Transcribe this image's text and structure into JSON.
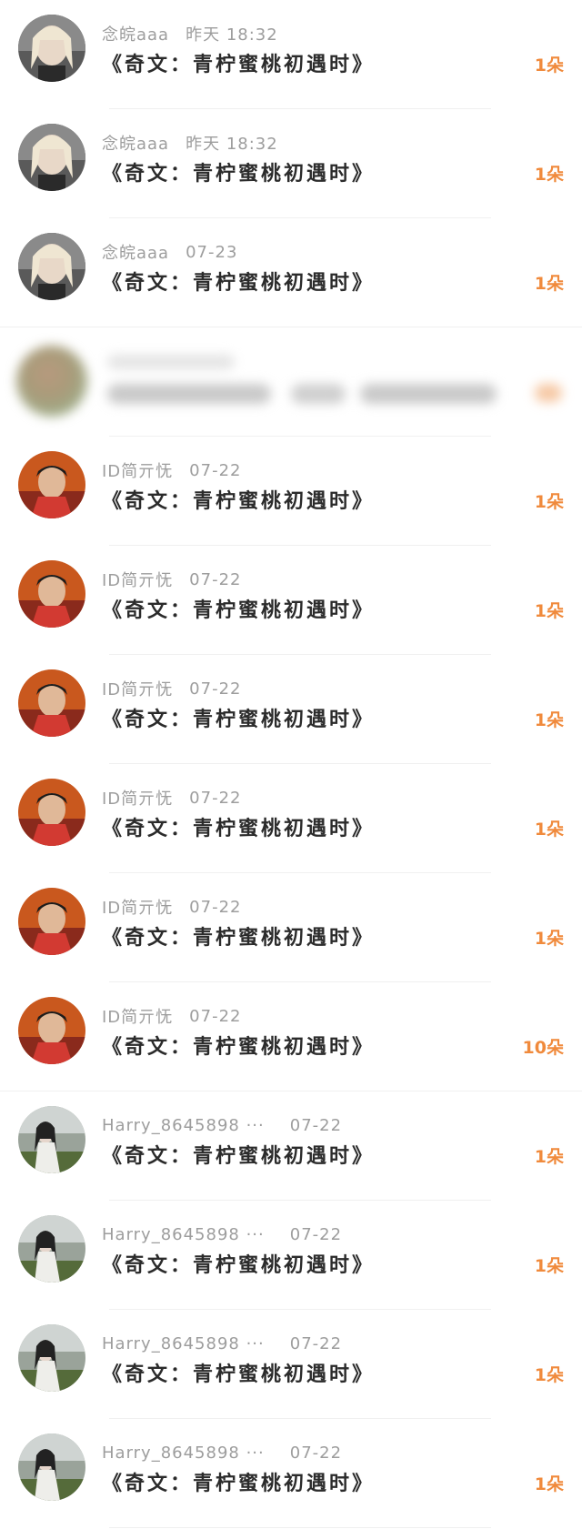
{
  "colors": {
    "username": "#9d9d9d",
    "title": "#2b2b2b",
    "count": "#f08a3c",
    "divider": "#f0f0f0"
  },
  "rows": [
    {
      "user": "念皖aaa",
      "time": "昨天 18:32",
      "title": "《奇文：青柠蜜桃初遇时》",
      "count": "1朵",
      "avatar": "girl-blonde"
    },
    {
      "user": "念皖aaa",
      "time": "昨天 18:32",
      "title": "《奇文：青柠蜜桃初遇时》",
      "count": "1朵",
      "avatar": "girl-blonde"
    },
    {
      "user": "念皖aaa",
      "time": "07-23",
      "title": "《奇文：青柠蜜桃初遇时》",
      "count": "1朵",
      "avatar": "girl-blonde"
    },
    {
      "user": "ID简亓怃",
      "time": "07-22",
      "title": "《奇文：青柠蜜桃初遇时》",
      "count": "1朵",
      "avatar": "boy-red"
    },
    {
      "user": "ID简亓怃",
      "time": "07-22",
      "title": "《奇文：青柠蜜桃初遇时》",
      "count": "1朵",
      "avatar": "boy-red"
    },
    {
      "user": "ID简亓怃",
      "time": "07-22",
      "title": "《奇文：青柠蜜桃初遇时》",
      "count": "1朵",
      "avatar": "boy-red"
    },
    {
      "user": "ID简亓怃",
      "time": "07-22",
      "title": "《奇文：青柠蜜桃初遇时》",
      "count": "1朵",
      "avatar": "boy-red"
    },
    {
      "user": "ID简亓怃",
      "time": "07-22",
      "title": "《奇文：青柠蜜桃初遇时》",
      "count": "1朵",
      "avatar": "boy-red"
    },
    {
      "user": "ID简亓怃",
      "time": "07-22",
      "title": "《奇文：青柠蜜桃初遇时》",
      "count": "10朵",
      "avatar": "boy-red"
    },
    {
      "user": "Harry_8645898 ···",
      "time": "07-22",
      "title": "《奇文：青柠蜜桃初遇时》",
      "count": "1朵",
      "avatar": "girl-landscape"
    },
    {
      "user": "Harry_8645898 ···",
      "time": "07-22",
      "title": "《奇文：青柠蜜桃初遇时》",
      "count": "1朵",
      "avatar": "girl-landscape"
    },
    {
      "user": "Harry_8645898 ···",
      "time": "07-22",
      "title": "《奇文：青柠蜜桃初遇时》",
      "count": "1朵",
      "avatar": "girl-landscape"
    },
    {
      "user": "Harry_8645898 ···",
      "time": "07-22",
      "title": "《奇文：青柠蜜桃初遇时》",
      "count": "1朵",
      "avatar": "girl-landscape"
    }
  ]
}
